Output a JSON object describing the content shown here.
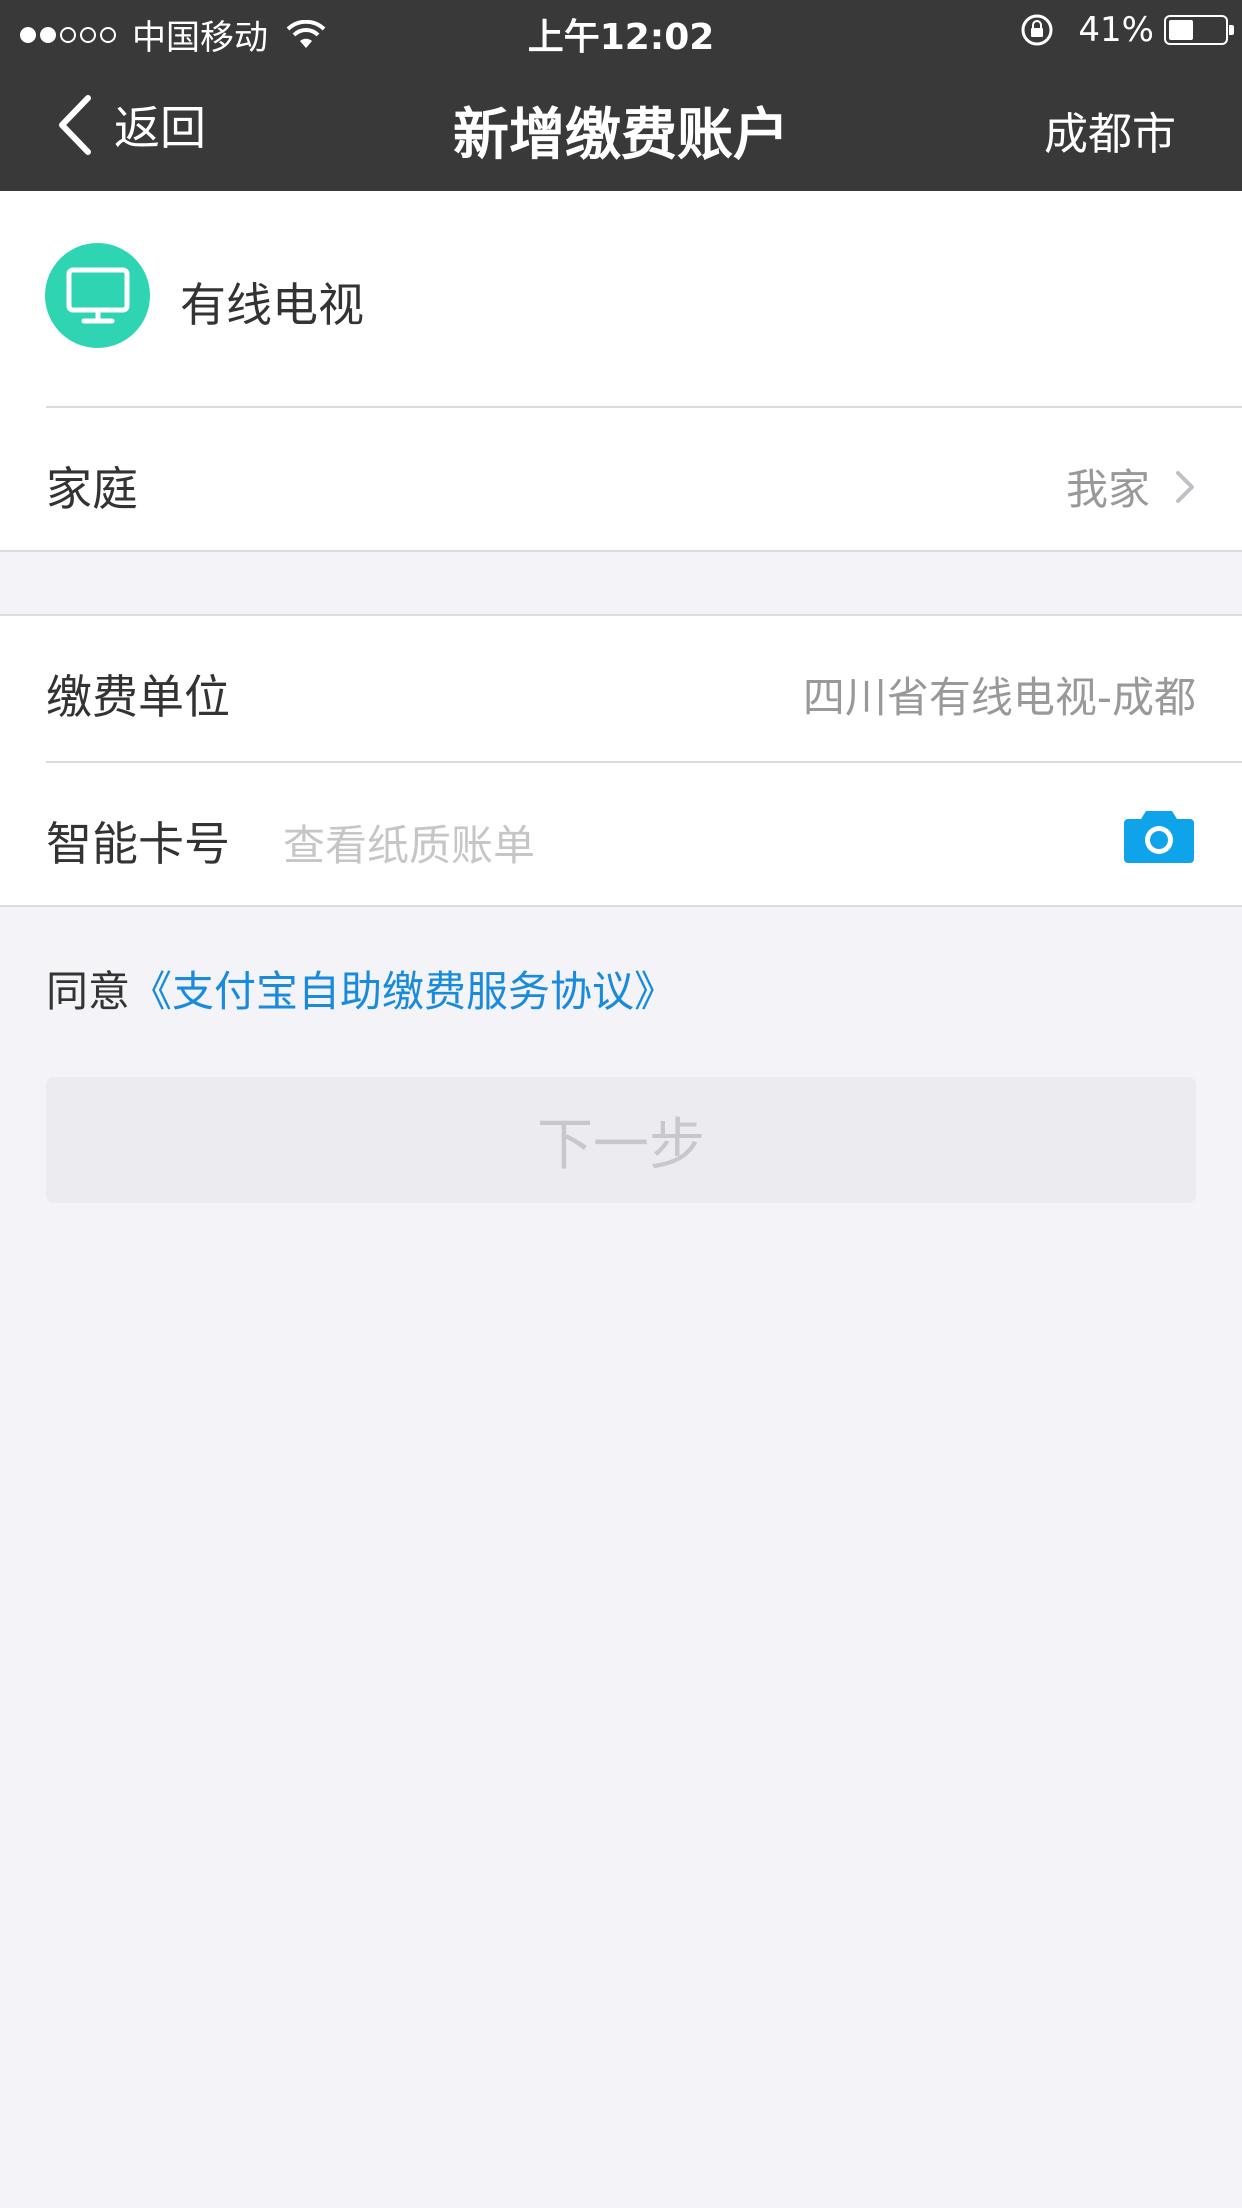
{
  "status_bar": {
    "carrier": "中国移动",
    "time": "上午12:02",
    "battery_percent": "41%",
    "battery_level": 0.41
  },
  "nav": {
    "back_label": "返回",
    "title": "新增缴费账户",
    "city": "成都市"
  },
  "service": {
    "name": "有线电视",
    "icon": "tv-icon",
    "icon_color": "#2fd4b3"
  },
  "family_row": {
    "label": "家庭",
    "value": "我家"
  },
  "unit_row": {
    "label": "缴费单位",
    "value": "四川省有线电视-成都"
  },
  "card_row": {
    "label": "智能卡号",
    "placeholder": "查看纸质账单"
  },
  "agreement": {
    "prefix": "同意",
    "link": "《支付宝自助缴费服务协议》",
    "link_color": "#1a8bdb"
  },
  "next_button": {
    "label": "下一步"
  }
}
